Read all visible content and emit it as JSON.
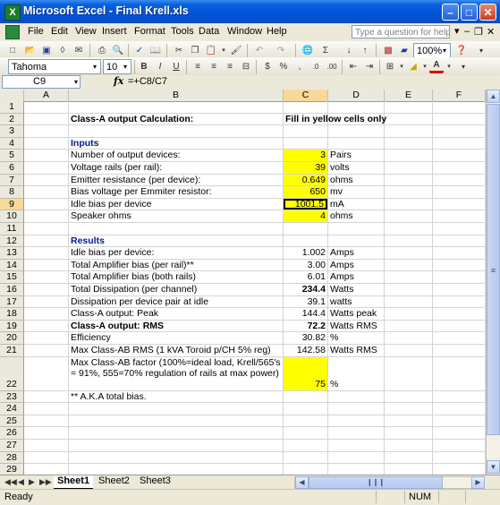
{
  "window": {
    "title": "Microsoft Excel - Final Krell.xls",
    "app_icon": "excel-icon"
  },
  "menu": {
    "items": [
      "File",
      "Edit",
      "View",
      "Insert",
      "Format",
      "Tools",
      "Data",
      "Window",
      "Help"
    ],
    "ask_placeholder": "Type a question for help"
  },
  "toolbar": {
    "zoom": "100%"
  },
  "format_toolbar": {
    "font": "Tahoma",
    "size": "10"
  },
  "formula_bar": {
    "name_box": "C9",
    "fx": "fx",
    "formula": "=+C8/C7"
  },
  "columns": [
    "A",
    "B",
    "C",
    "D",
    "E",
    "F"
  ],
  "rows": [
    "1",
    "2",
    "3",
    "4",
    "5",
    "6",
    "7",
    "8",
    "9",
    "10",
    "11",
    "12",
    "13",
    "14",
    "15",
    "16",
    "17",
    "18",
    "19",
    "20",
    "21",
    "22",
    "23",
    "24",
    "25",
    "26",
    "27",
    "28",
    "29"
  ],
  "cells": {
    "b2": "Class-A output Calculation:",
    "c2": "Fill in yellow cells only",
    "b4": "Inputs",
    "b5": "Number of output devices:",
    "c5": "3",
    "d5": "Pairs",
    "b6": "Voltage rails (per rail):",
    "c6": "39",
    "d6": "volts",
    "b7": "Emitter resistance (per device):",
    "c7": "0.649",
    "d7": "ohms",
    "b8": "Bias voltage per Emmiter resistor:",
    "c8": "650",
    "d8": "mv",
    "b9": "Idle bias per device",
    "c9": "1001.5",
    "d9": "mA",
    "b10": "Speaker ohms",
    "c10": "4",
    "d10": "ohms",
    "b12": "Results",
    "b13": "Idle bias per device:",
    "c13": "1.002",
    "d13": "Amps",
    "b14": "Total Amplifier bias (per rail)**",
    "c14": "3.00",
    "d14": "Amps",
    "b15": "Total Amplifier bias (both rails)",
    "c15": "6.01",
    "d15": "Amps",
    "b16": "Total Dissipation (per channel)",
    "c16": "234.4",
    "d16": "Watts",
    "b17": "Dissipation per device pair at idle",
    "c17": "39.1",
    "d17": "watts",
    "b18": "Class-A output: Peak",
    "c18": "144.4",
    "d18": "Watts peak",
    "b19": "Class-A output: RMS",
    "c19": "72.2",
    "d19": "Watts RMS",
    "b20": "Efficiency",
    "c20": "30.82",
    "d20": "%",
    "b21": "Max Class-AB RMS (1 kVA Toroid p/CH 5% reg)",
    "c21": "142.58",
    "d21": "Watts RMS",
    "b22": "Max Class-AB factor (100%=ideal load, Krell/565's = 91%, 555=70% regulation of rails at max power)",
    "c22": "75",
    "d22": "%",
    "b23": "** A.K.A total bias."
  },
  "sheet_tabs": [
    "Sheet1",
    "Sheet2",
    "Sheet3"
  ],
  "status": {
    "left": "Ready",
    "num": "NUM"
  },
  "colors": {
    "input_fill": "#ffff00",
    "section_header": "#001a8f",
    "selection": "#f9d99a"
  }
}
